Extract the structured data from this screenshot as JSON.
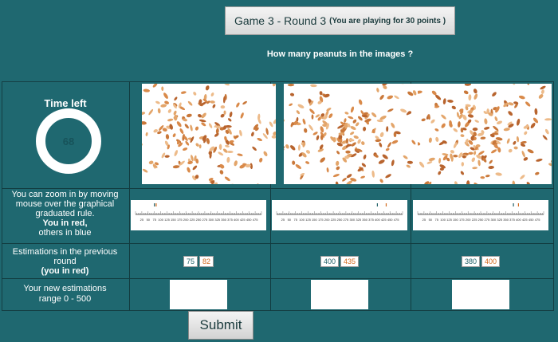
{
  "header": {
    "title": "Game 3 - Round 3",
    "subtitle": "(You are playing for 30 points )",
    "question": "How many peanuts in the images ?"
  },
  "timer": {
    "label": "Time left",
    "value": "68"
  },
  "zoom_help": {
    "line1": "You can zoom in by moving mouse over the graphical graduated rule.",
    "line2": "You in red,",
    "line3": "others in blue"
  },
  "previous": {
    "label1": "Estimations in the previous round",
    "label2": "(you in red)",
    "columns": [
      {
        "others": "75",
        "you": "82"
      },
      {
        "others": "400",
        "you": "435"
      },
      {
        "others": "380",
        "you": "400"
      }
    ]
  },
  "new_estimation": {
    "label1": "Your new estimations",
    "label2": "range 0 - 500"
  },
  "rule_ticks": [
    "25",
    "50",
    "75",
    "100",
    "125",
    "150",
    "175",
    "200",
    "225",
    "250",
    "275",
    "300",
    "325",
    "350",
    "375",
    "400",
    "425",
    "450",
    "475"
  ],
  "submit_label": "Submit",
  "colors": {
    "background": "#1f6870",
    "you": "#d2691e",
    "others": "#1f5f66"
  }
}
